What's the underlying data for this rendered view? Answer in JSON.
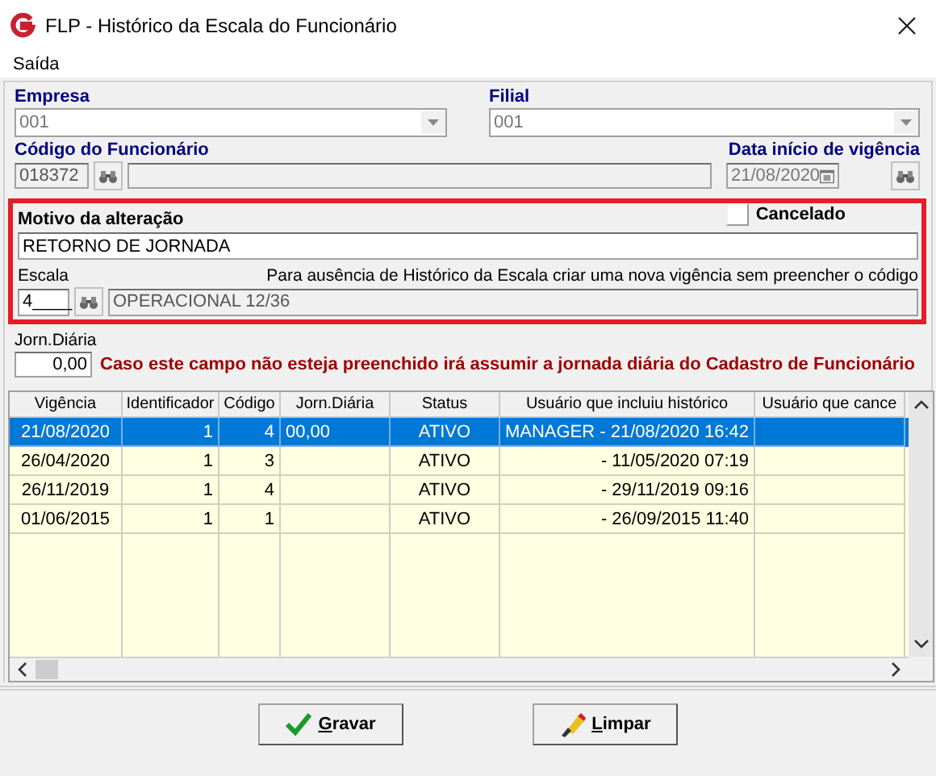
{
  "window": {
    "title": "FLP - Histórico da Escala do Funcionário"
  },
  "menu": [
    "Saída"
  ],
  "empresa": {
    "label": "Empresa",
    "value": "001"
  },
  "filial": {
    "label": "Filial",
    "value": "001"
  },
  "funcionario": {
    "label": "Código do Funcionário",
    "value": "018372"
  },
  "vigencia": {
    "label": "Data início de vigência",
    "value": "21/08/2020"
  },
  "cancelado": {
    "label": "Cancelado",
    "checked": false
  },
  "motivo": {
    "label": "Motivo da alteração",
    "value": "RETORNO DE JORNADA"
  },
  "escala": {
    "label": "Escala",
    "value": "4____",
    "description": "OPERACIONAL 12/36",
    "hint": "Para ausência de Histórico da Escala criar uma nova vigência sem preencher o código"
  },
  "jornada": {
    "label": "Jorn.Diária",
    "value": "0,00",
    "note": "Caso este campo não esteja preenchido irá assumir a jornada diária do Cadastro de Funcionário"
  },
  "table": {
    "columns": [
      "Vigência",
      "Identificador",
      "Código",
      "Jorn.Diária",
      "Status",
      "Usuário que incluiu histórico",
      "Usuário que cance"
    ],
    "rows": [
      {
        "selected": true,
        "cells": [
          "21/08/2020",
          "1",
          "4",
          "00,00",
          "ATIVO",
          "MANAGER - 21/08/2020 16:42",
          ""
        ]
      },
      {
        "selected": false,
        "cells": [
          "26/04/2020",
          "1",
          "3",
          "",
          "ATIVO",
          "- 11/05/2020 07:19",
          ""
        ]
      },
      {
        "selected": false,
        "cells": [
          "26/11/2019",
          "1",
          "4",
          "",
          "ATIVO",
          "- 29/11/2019 09:16",
          ""
        ]
      },
      {
        "selected": false,
        "cells": [
          "01/06/2015",
          "1",
          "1",
          "",
          "ATIVO",
          "- 26/09/2015 11:40",
          ""
        ]
      }
    ]
  },
  "buttons": [
    {
      "label": "Gravar"
    },
    {
      "label": "Limpar"
    }
  ]
}
